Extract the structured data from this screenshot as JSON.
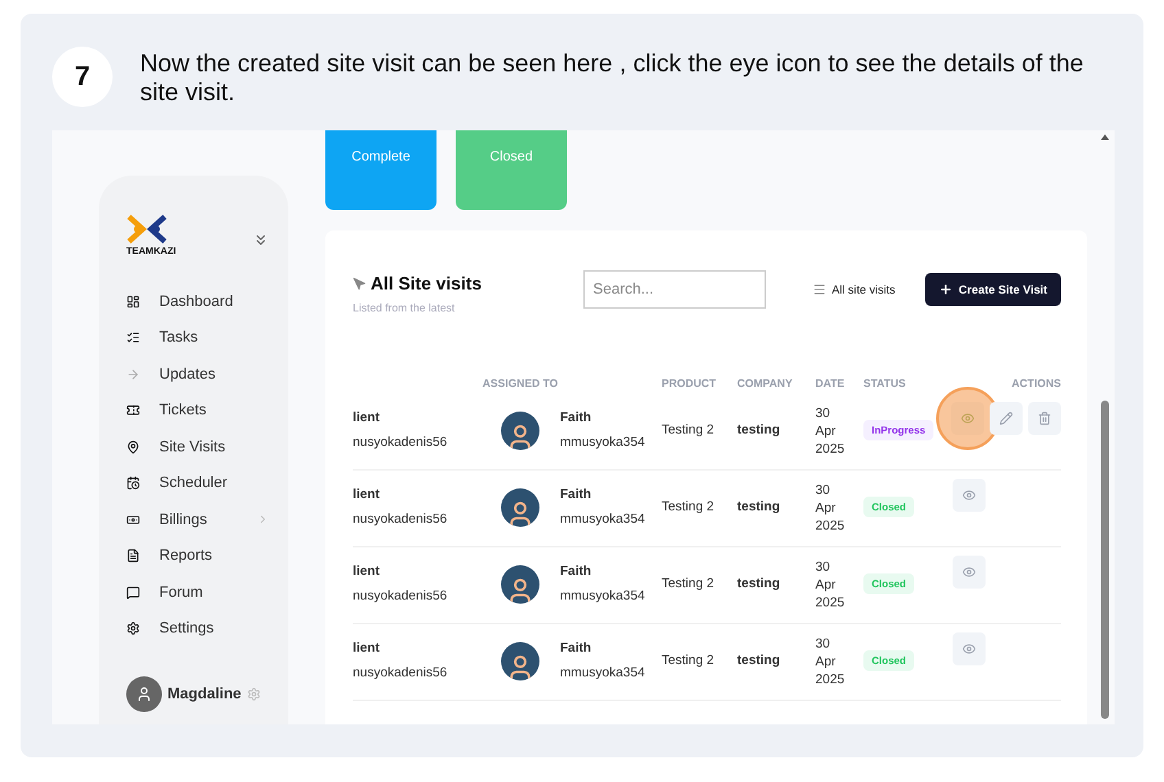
{
  "step": {
    "number": "7",
    "text": "Now the created site visit can be seen here , click the eye icon to see the details of the site visit."
  },
  "summary_cards": [
    {
      "label": "Complete",
      "kind": "blue"
    },
    {
      "label": "Closed",
      "kind": "green"
    }
  ],
  "sidebar": {
    "logo_text": "TEAMKAZI",
    "items": [
      {
        "label": "Dashboard",
        "has_submenu": false
      },
      {
        "label": "Tasks",
        "has_submenu": false
      },
      {
        "label": "Updates",
        "has_submenu": false
      },
      {
        "label": "Tickets",
        "has_submenu": false
      },
      {
        "label": "Site Visits",
        "has_submenu": false
      },
      {
        "label": "Scheduler",
        "has_submenu": false
      },
      {
        "label": "Billings",
        "has_submenu": true
      },
      {
        "label": "Reports",
        "has_submenu": false
      },
      {
        "label": "Forum",
        "has_submenu": false
      },
      {
        "label": "Settings",
        "has_submenu": false
      }
    ],
    "user": {
      "name": "Magdaline"
    }
  },
  "panel": {
    "title": "All Site visits",
    "subtitle": "Listed from the latest",
    "search": {
      "placeholder": "Search..."
    },
    "filter": "All site visits",
    "create_button": "Create Site Visit"
  },
  "table": {
    "columns": [
      "",
      "ASSIGNED TO",
      "",
      "PRODUCT",
      "COMPANY",
      "DATE",
      "STATUS",
      "ACTIONS"
    ],
    "rows": [
      {
        "client": "lient",
        "client_email": "nusyokadenis56",
        "assignee": "Faith",
        "assignee_email": "mmusyoka354",
        "product": "Testing 2",
        "company": "testing",
        "date": "30 Apr 2025",
        "status": {
          "label": "InProgress",
          "kind": "inprogress"
        },
        "actions": [
          {
            "kind": "view",
            "highlighted": true
          },
          {
            "kind": "edit",
            "highlighted": false
          },
          {
            "kind": "delete",
            "highlighted": false
          }
        ]
      },
      {
        "client": "lient",
        "client_email": "nusyokadenis56",
        "assignee": "Faith",
        "assignee_email": "mmusyoka354",
        "product": "Testing 2",
        "company": "testing",
        "date": "30 Apr 2025",
        "status": {
          "label": "Closed",
          "kind": "closed"
        },
        "actions": [
          {
            "kind": "view",
            "highlighted": false
          }
        ]
      },
      {
        "client": "lient",
        "client_email": "nusyokadenis56",
        "assignee": "Faith",
        "assignee_email": "mmusyoka354",
        "product": "Testing 2",
        "company": "testing",
        "date": "30 Apr 2025",
        "status": {
          "label": "Closed",
          "kind": "closed"
        },
        "actions": [
          {
            "kind": "view",
            "highlighted": false
          }
        ]
      },
      {
        "client": "lient",
        "client_email": "nusyokadenis56",
        "assignee": "Faith",
        "assignee_email": "mmusyoka354",
        "product": "Testing 2",
        "company": "testing",
        "date": "30 Apr 2025",
        "status": {
          "label": "Closed",
          "kind": "closed"
        },
        "actions": [
          {
            "kind": "view",
            "highlighted": false
          }
        ]
      }
    ]
  }
}
